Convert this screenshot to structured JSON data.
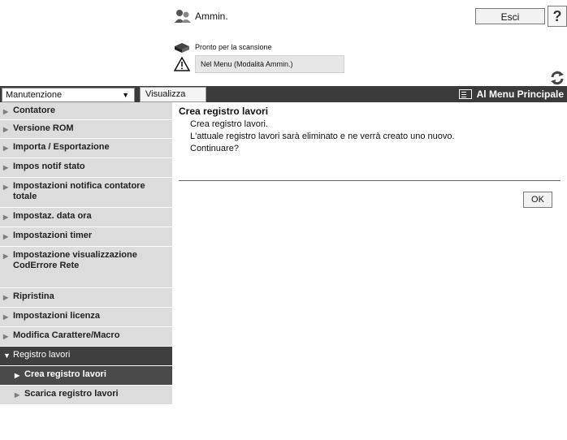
{
  "header": {
    "user_label": "Ammin.",
    "logout_label": "Esci",
    "help_label": "?",
    "scan_status": "Pronto per la scansione",
    "mode_status": "Nel Menu (Modalità Ammin.)"
  },
  "toolbar": {
    "category_select": "Manutenzione",
    "view_button": "Visualizza",
    "main_menu_label": "Al Menu Principale"
  },
  "sidebar": {
    "items": [
      {
        "label": "Contatore"
      },
      {
        "label": "Versione ROM"
      },
      {
        "label": "Importa / Esportazione"
      },
      {
        "label": "Impos notif stato"
      },
      {
        "label": "Impostazioni notifica contatore totale"
      },
      {
        "label": "Impostaz. data ora"
      },
      {
        "label": "Impostazioni timer"
      },
      {
        "label": "Impostazione visualizzazione CodErrore Rete"
      },
      {
        "label": "Ripristina"
      },
      {
        "label": "Impostazioni licenza"
      },
      {
        "label": "Modifica Carattere/Macro"
      },
      {
        "label": "Registro lavori"
      },
      {
        "label": "Crea registro lavori"
      },
      {
        "label": "Scarica registro lavori"
      }
    ]
  },
  "main": {
    "title": "Crea registro lavori",
    "lines": [
      "Crea registro lavori.",
      "L'attuale registro lavori sarà eliminato e ne verrà creato uno nuovo.",
      "Continuare?"
    ],
    "ok_label": "OK"
  }
}
